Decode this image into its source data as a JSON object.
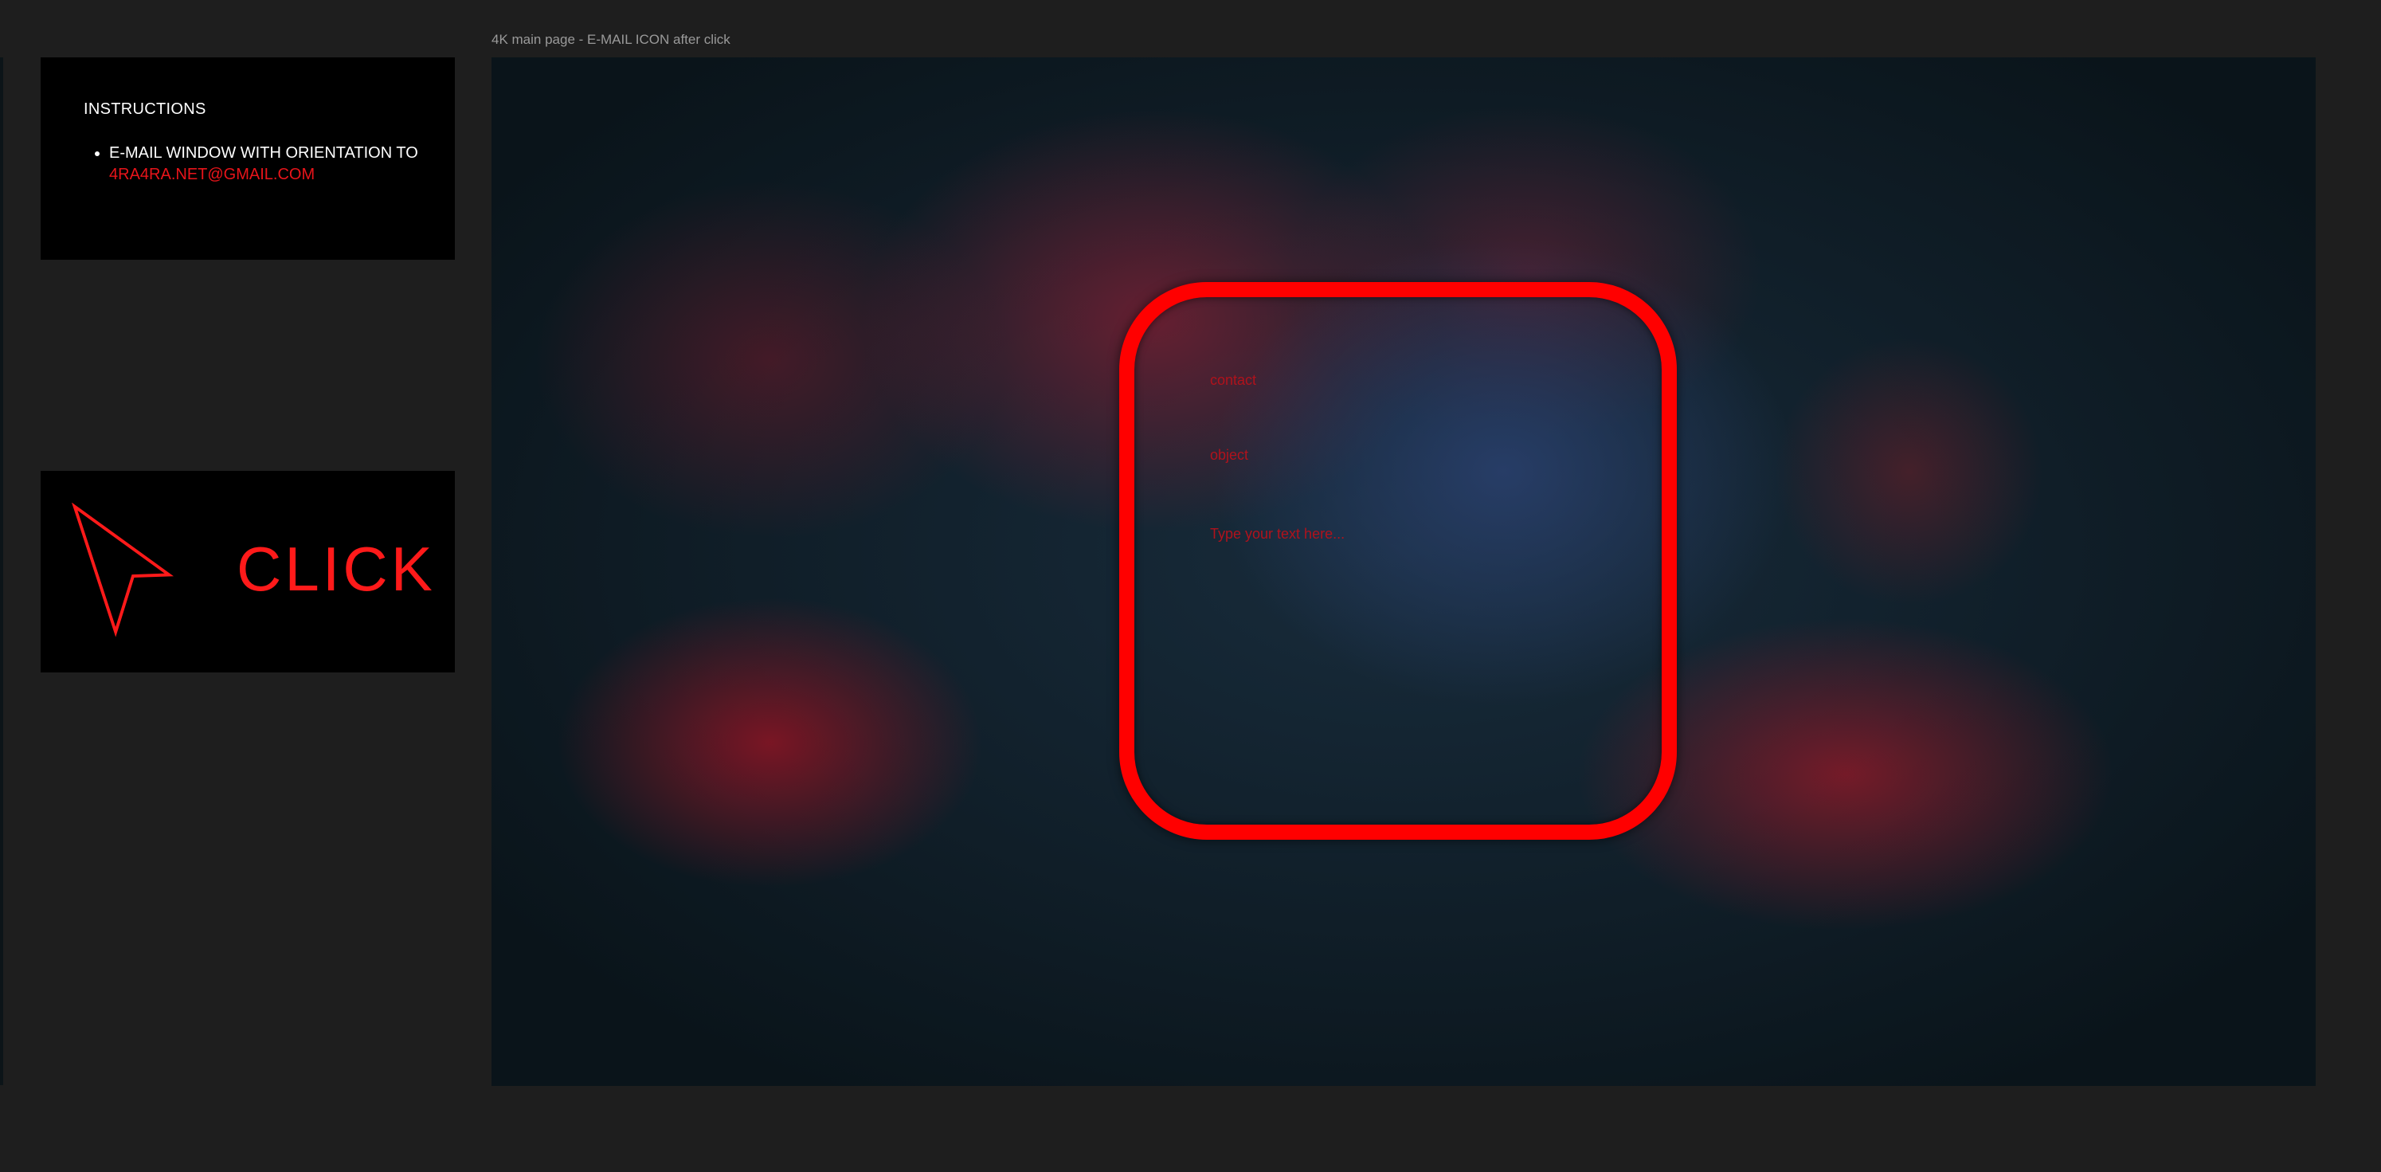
{
  "frame": {
    "label": "4K main page - E-MAIL ICON after click"
  },
  "instructions": {
    "title": "INSTRUCTIONS",
    "item_text": "E-MAIL WINDOW WITH ORIENTATION TO",
    "item_email": "4RA4RA.NET@GMAIL.COM"
  },
  "click_panel": {
    "label": "CLICK",
    "icon": "cursor-arrow-icon"
  },
  "email_window": {
    "contact_placeholder": "contact",
    "object_placeholder": "object",
    "message_placeholder": "Type your text here..."
  },
  "colors": {
    "accent": "#ff0000",
    "panel_bg": "#000000",
    "app_bg": "#1e1e1e",
    "placeholder_text": "#b0121c"
  }
}
